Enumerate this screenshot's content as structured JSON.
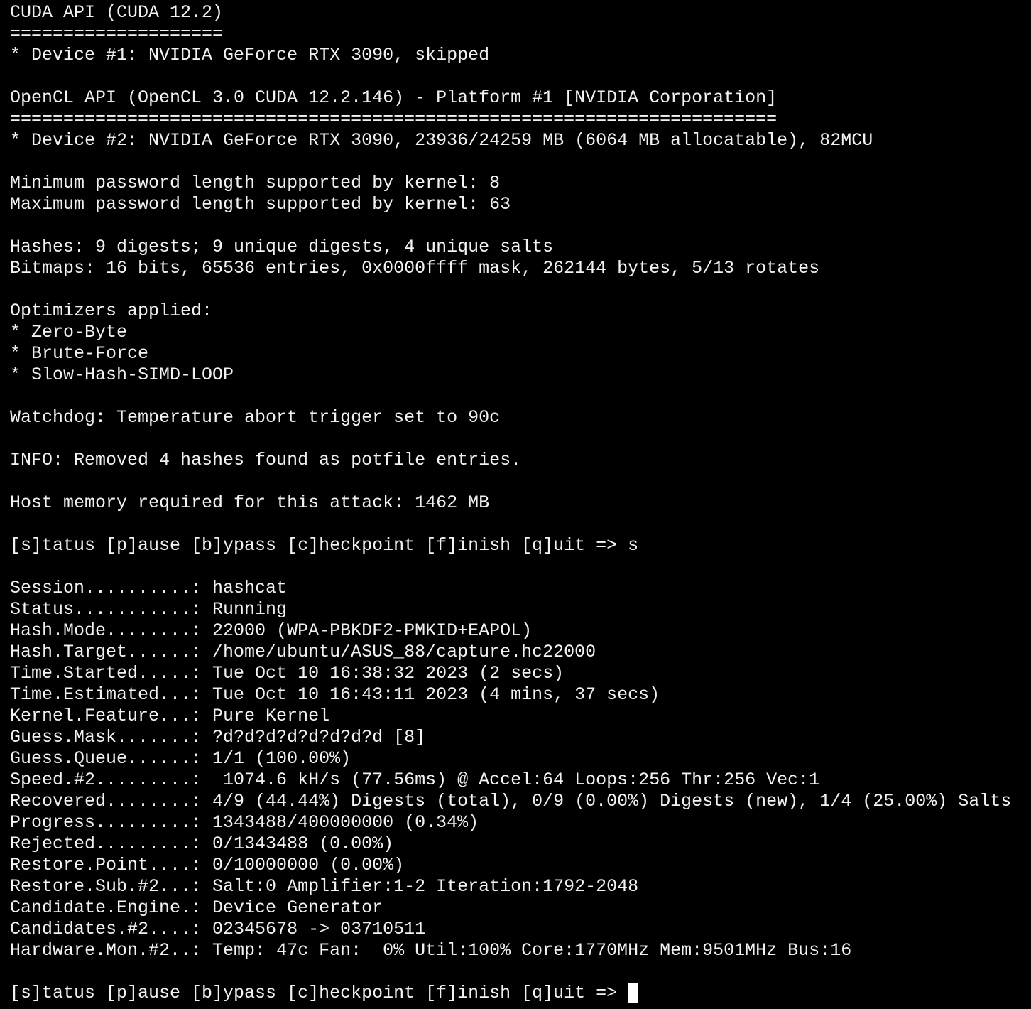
{
  "terminal": {
    "lines": [
      "CUDA API (CUDA 12.2)",
      "====================",
      "* Device #1: NVIDIA GeForce RTX 3090, skipped",
      "",
      "OpenCL API (OpenCL 3.0 CUDA 12.2.146) - Platform #1 [NVIDIA Corporation]",
      "========================================================================",
      "* Device #2: NVIDIA GeForce RTX 3090, 23936/24259 MB (6064 MB allocatable), 82MCU",
      "",
      "Minimum password length supported by kernel: 8",
      "Maximum password length supported by kernel: 63",
      "",
      "Hashes: 9 digests; 9 unique digests, 4 unique salts",
      "Bitmaps: 16 bits, 65536 entries, 0x0000ffff mask, 262144 bytes, 5/13 rotates",
      "",
      "Optimizers applied:",
      "* Zero-Byte",
      "* Brute-Force",
      "* Slow-Hash-SIMD-LOOP",
      "",
      "Watchdog: Temperature abort trigger set to 90c",
      "",
      "INFO: Removed 4 hashes found as potfile entries.",
      "",
      "Host memory required for this attack: 1462 MB",
      "",
      "[s]tatus [p]ause [b]ypass [c]heckpoint [f]inish [q]uit => s",
      "",
      "Session..........: hashcat",
      "Status...........: Running",
      "Hash.Mode........: 22000 (WPA-PBKDF2-PMKID+EAPOL)",
      "Hash.Target......: /home/ubuntu/ASUS_88/capture.hc22000",
      "Time.Started.....: Tue Oct 10 16:38:32 2023 (2 secs)",
      "Time.Estimated...: Tue Oct 10 16:43:11 2023 (4 mins, 37 secs)",
      "Kernel.Feature...: Pure Kernel",
      "Guess.Mask.......: ?d?d?d?d?d?d?d?d [8]",
      "Guess.Queue......: 1/1 (100.00%)",
      "Speed.#2.........:  1074.6 kH/s (77.56ms) @ Accel:64 Loops:256 Thr:256 Vec:1",
      "Recovered........: 4/9 (44.44%) Digests (total), 0/9 (0.00%) Digests (new), 1/4 (25.00%) Salts",
      "Progress.........: 1343488/400000000 (0.34%)",
      "Rejected.........: 0/1343488 (0.00%)",
      "Restore.Point....: 0/10000000 (0.00%)",
      "Restore.Sub.#2...: Salt:0 Amplifier:1-2 Iteration:1792-2048",
      "Candidate.Engine.: Device Generator",
      "Candidates.#2....: 02345678 -> 03710511",
      "Hardware.Mon.#2..: Temp: 47c Fan:  0% Util:100% Core:1770MHz Mem:9501MHz Bus:16",
      ""
    ],
    "prompt": "[s]tatus [p]ause [b]ypass [c]heckpoint [f]inish [q]uit =>"
  }
}
